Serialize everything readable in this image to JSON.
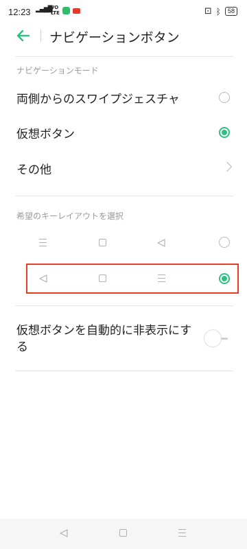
{
  "status_bar": {
    "time": "12:23",
    "signal": "4G",
    "volte_top": "VO",
    "volte_bottom": "LTE",
    "battery": "58"
  },
  "header": {
    "title": "ナビゲーションボタン",
    "back_icon": "arrow-left-icon"
  },
  "navigation_mode": {
    "section_label": "ナビゲーションモード",
    "options": [
      {
        "label": "両側からのスワイプジェスチャ",
        "selected": false
      },
      {
        "label": "仮想ボタン",
        "selected": true
      },
      {
        "label": "その他",
        "type": "link"
      }
    ]
  },
  "key_layout": {
    "section_label": "希望のキーレイアウトを選択",
    "layouts": [
      {
        "icons": [
          "menu-icon",
          "home-square-icon",
          "back-triangle-icon"
        ],
        "selected": false
      },
      {
        "icons": [
          "back-triangle-icon",
          "home-square-icon",
          "menu-icon"
        ],
        "selected": true
      }
    ]
  },
  "auto_hide": {
    "label_line1": "仮想ボタンを自動的に非表示にす",
    "label_line2": "る",
    "enabled": false
  },
  "system_nav": {
    "icons": [
      "back-triangle-icon",
      "home-square-icon",
      "menu-icon"
    ]
  },
  "colors": {
    "accent": "#2fbf83",
    "highlight": "#e53c24"
  }
}
